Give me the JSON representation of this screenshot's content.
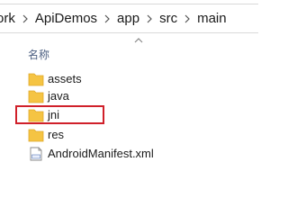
{
  "breadcrumb": {
    "items": [
      "ork",
      "ApiDemos",
      "app",
      "src",
      "main"
    ]
  },
  "columns": {
    "name_header": "名称"
  },
  "files": [
    {
      "name": "assets",
      "type": "folder"
    },
    {
      "name": "java",
      "type": "folder"
    },
    {
      "name": "jni",
      "type": "folder"
    },
    {
      "name": "res",
      "type": "folder"
    },
    {
      "name": "AndroidManifest.xml",
      "type": "xml-file"
    }
  ],
  "colors": {
    "folder": "#f5c443",
    "highlight_border": "#d0202a",
    "header_text": "#4d6082"
  }
}
